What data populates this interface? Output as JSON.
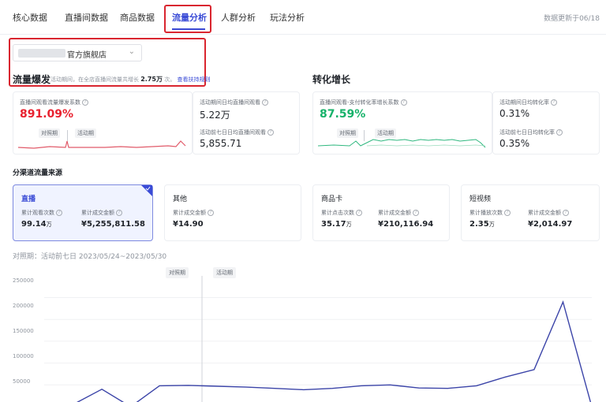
{
  "tabs": [
    "核心数据",
    "直播间数据",
    "商品数据",
    "流量分析",
    "人群分析",
    "玩法分析"
  ],
  "update_note": "数据更新于06/18",
  "store": {
    "name": "官方旗舰店"
  },
  "traffic": {
    "title": "流量爆发",
    "note_prefix": "活动期间，在全店直播间流量共增长",
    "note_value": "2.75万",
    "note_suffix": "次。",
    "note_link": "查看扶持规则",
    "main_label": "直播间观看流量爆发系数",
    "main_value": "891.09%",
    "stat1_label": "活动期间日均直播间观看",
    "stat1_value": "5.22万",
    "stat2_label": "活动前七日日均直播间观看",
    "stat2_value": "5,855.71",
    "tag_before": "对照期",
    "tag_active": "活动期"
  },
  "conversion": {
    "title": "转化增长",
    "main_label": "直播间观看-支付转化率增长系数",
    "main_value": "87.59%",
    "stat1_label": "活动期间日均转化率",
    "stat1_value": "0.31%",
    "stat2_label": "活动前七日日均转化率",
    "stat2_value": "0.35%",
    "tag_before": "对照期",
    "tag_active": "活动期"
  },
  "channels": {
    "title": "分渠道流量来源",
    "items": [
      {
        "name": "直播",
        "active": true,
        "m1_label": "累计观看次数",
        "m1_value": "99.14",
        "m1_unit": "万",
        "m2_label": "累计成交金额",
        "m2_value": "¥5,255,811.58"
      },
      {
        "name": "其他",
        "active": false,
        "m1_label": "累计成交金额",
        "m1_value": "¥14.90",
        "m1_unit": "",
        "m2_label": "",
        "m2_value": ""
      },
      {
        "name": "商品卡",
        "active": false,
        "m1_label": "累计点击次数",
        "m1_value": "35.17",
        "m1_unit": "万",
        "m2_label": "累计成交金额",
        "m2_value": "¥210,116.94"
      },
      {
        "name": "短视频",
        "active": false,
        "m1_label": "累计播放次数",
        "m1_value": "2.35",
        "m1_unit": "万",
        "m2_label": "累计成交金额",
        "m2_value": "¥2,014.97"
      }
    ]
  },
  "chart_caption": "对照期：活动前七日 2023/05/24~2023/05/30",
  "chart_data": {
    "type": "line",
    "y_ticks": [
      "250000",
      "200000",
      "150000",
      "100000",
      "50000"
    ],
    "ylim": [
      0,
      260000
    ],
    "phase_labels": [
      "对照期",
      "活动期"
    ],
    "series": [
      {
        "values": [
          0,
          5000,
          40000,
          0,
          48000,
          49000,
          47000,
          45000,
          42000,
          39000,
          42000,
          48000,
          50000,
          43000,
          42000,
          48000,
          68000,
          85000,
          240000,
          0
        ]
      }
    ],
    "line_color": "#3b44a8"
  }
}
